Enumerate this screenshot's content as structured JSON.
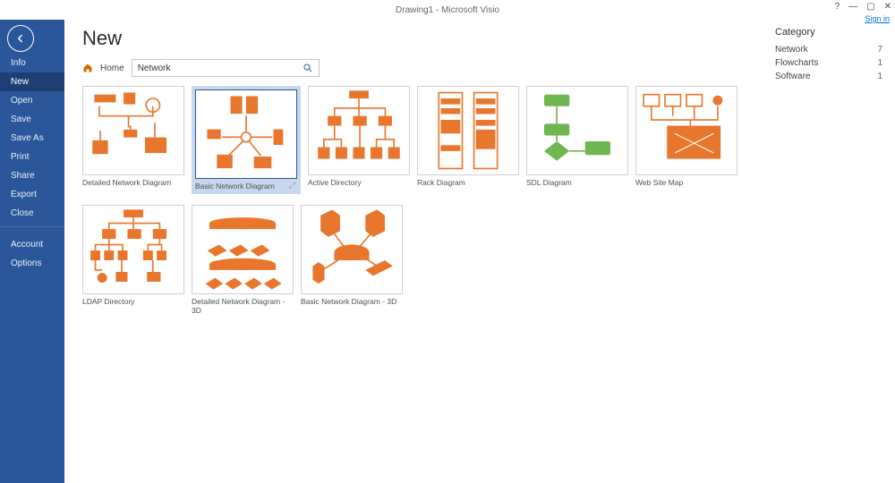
{
  "titlebar": {
    "title": "Drawing1 - Microsoft Visio",
    "signin": "Sign in"
  },
  "sidebar": {
    "items": [
      {
        "label": "Info"
      },
      {
        "label": "New"
      },
      {
        "label": "Open"
      },
      {
        "label": "Save"
      },
      {
        "label": "Save As"
      },
      {
        "label": "Print"
      },
      {
        "label": "Share"
      },
      {
        "label": "Export"
      },
      {
        "label": "Close"
      }
    ],
    "footer": [
      {
        "label": "Account"
      },
      {
        "label": "Options"
      }
    ]
  },
  "page": {
    "title": "New",
    "breadcrumb": "Home",
    "search_value": "Network"
  },
  "templates": [
    {
      "label": "Detailed Network Diagram",
      "kind": "net1"
    },
    {
      "label": "Basic Network Diagram",
      "kind": "net2",
      "selected": true
    },
    {
      "label": "Active Directory",
      "kind": "ad"
    },
    {
      "label": "Rack Diagram",
      "kind": "rack"
    },
    {
      "label": "SDL Diagram",
      "kind": "sdl"
    },
    {
      "label": "Web Site Map",
      "kind": "web"
    },
    {
      "label": "LDAP Directory",
      "kind": "ldap"
    },
    {
      "label": "Detailed Network Diagram - 3D",
      "kind": "net3d1"
    },
    {
      "label": "Basic Network Diagram - 3D",
      "kind": "net3d2"
    }
  ],
  "categories": {
    "title": "Category",
    "items": [
      {
        "label": "Network",
        "count": 7
      },
      {
        "label": "Flowcharts",
        "count": 1
      },
      {
        "label": "Software",
        "count": 1
      }
    ]
  }
}
